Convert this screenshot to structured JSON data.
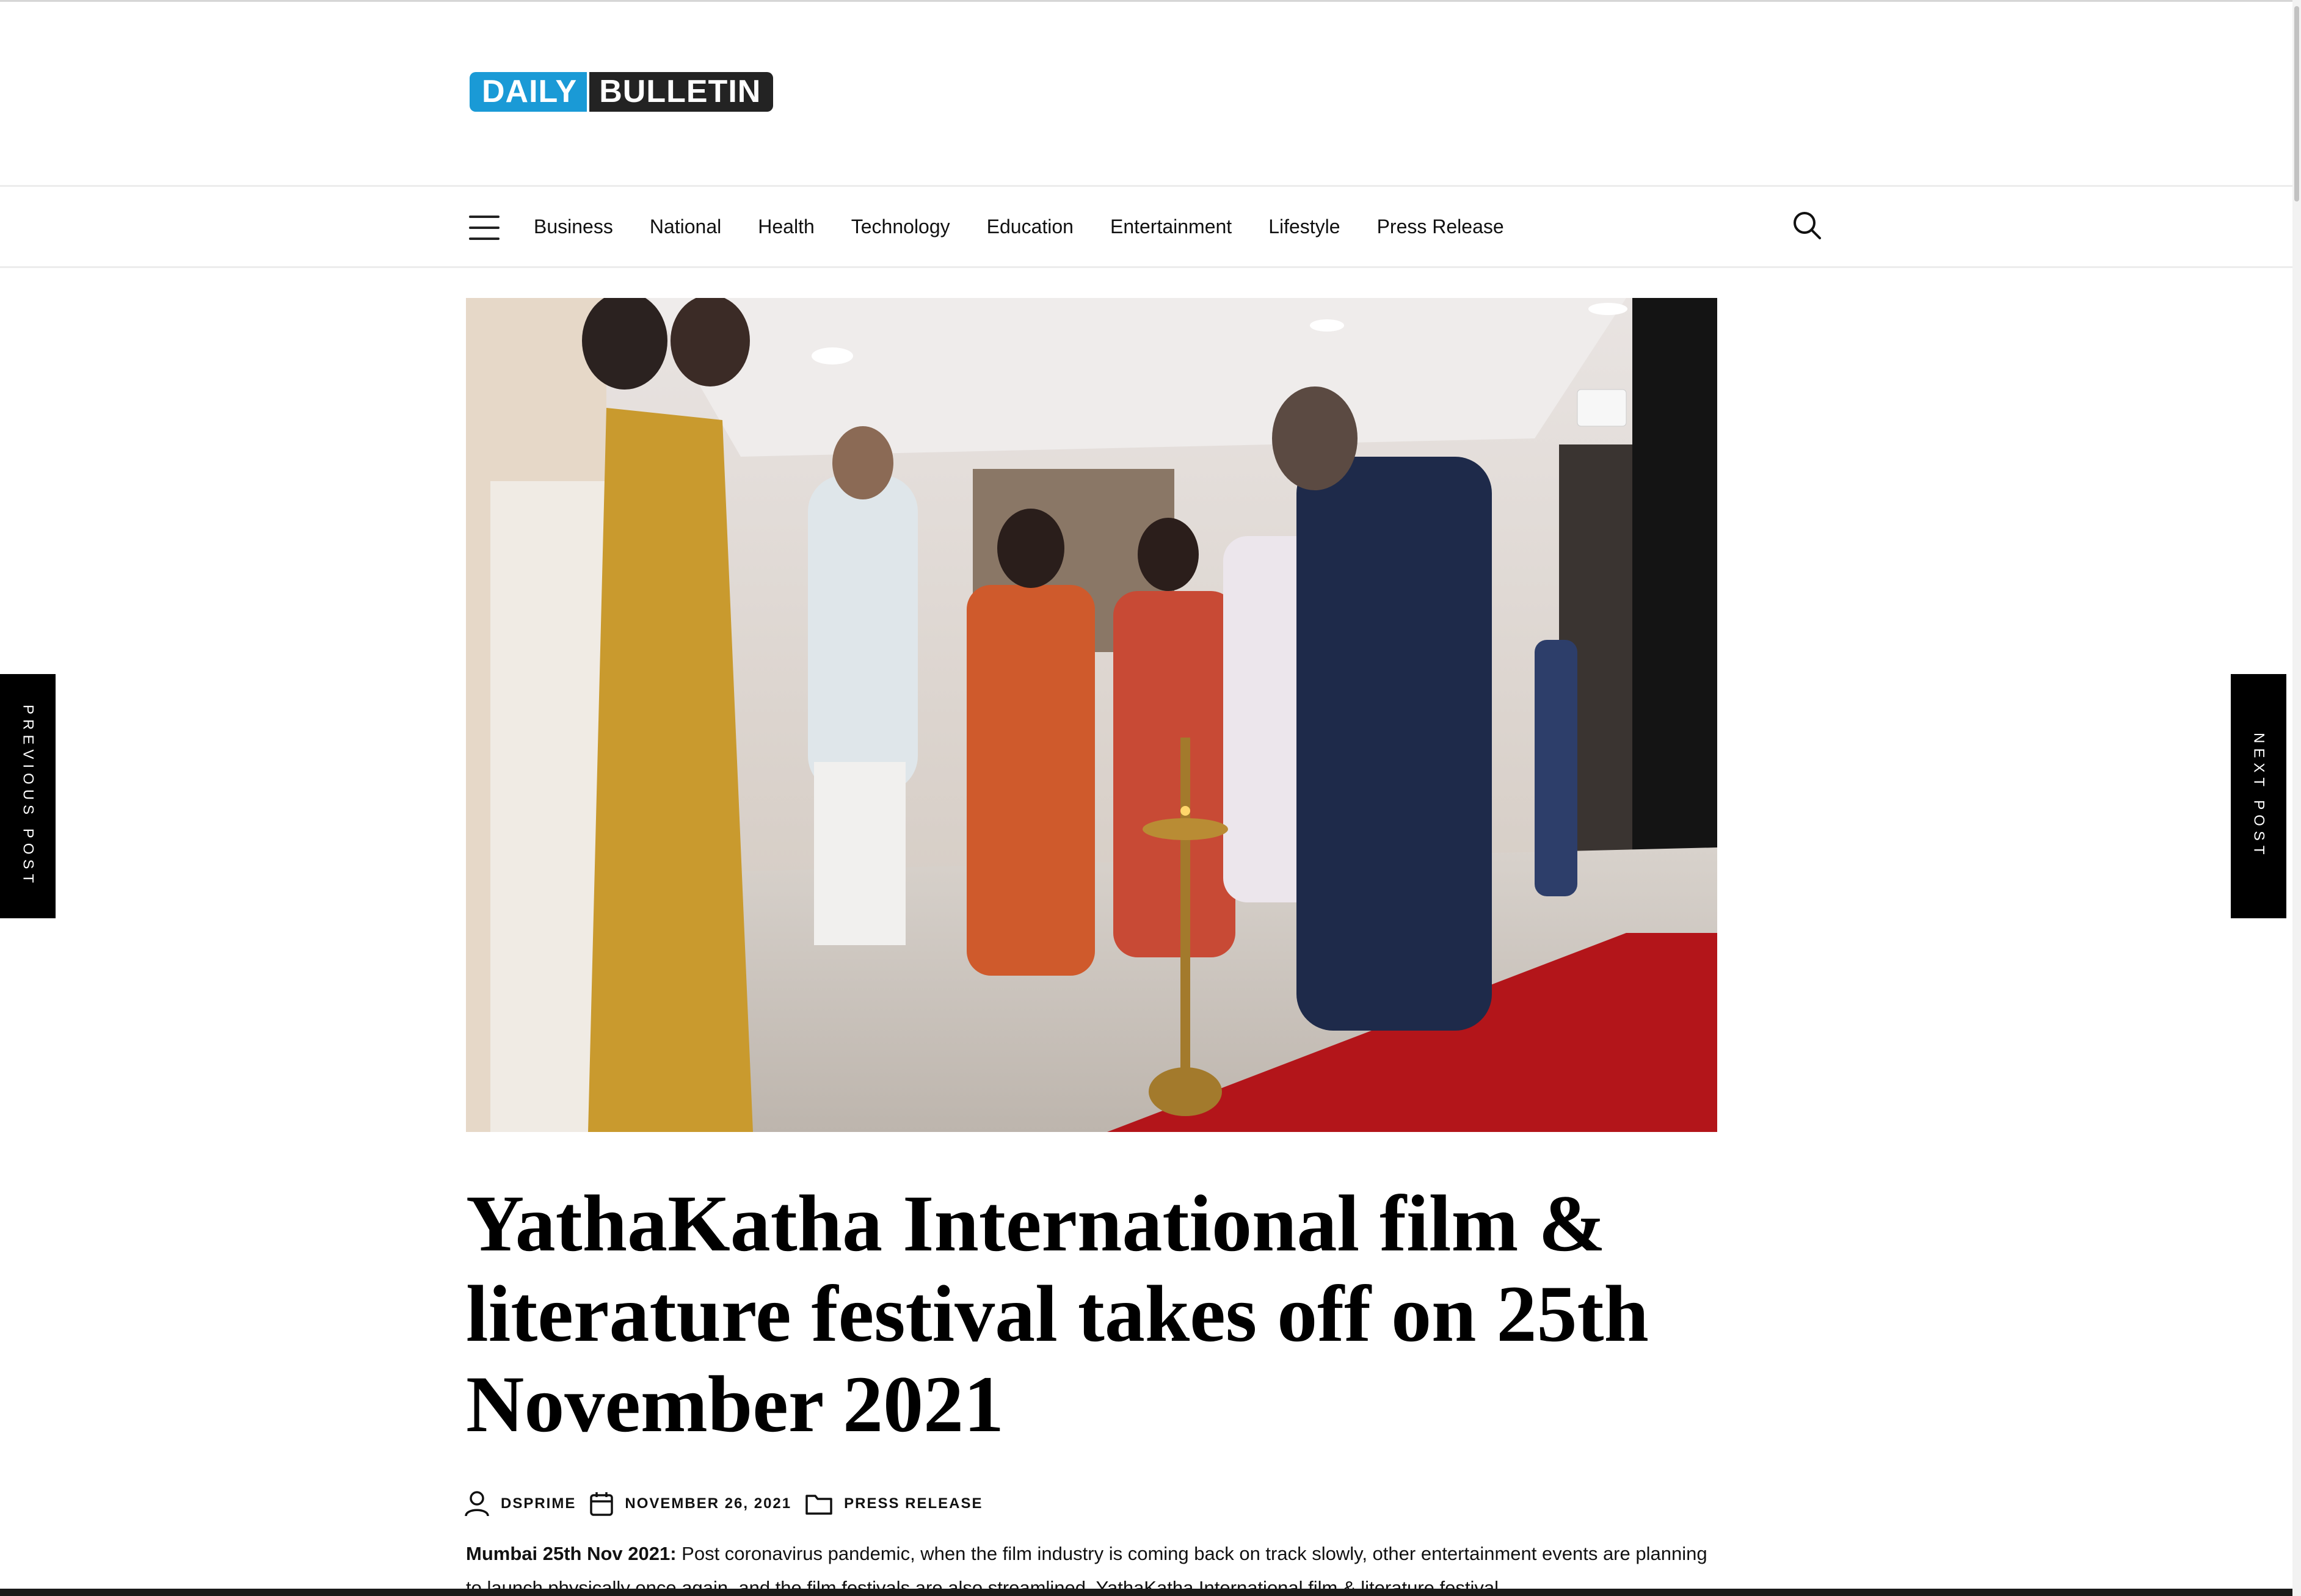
{
  "logo": {
    "part1": "DAILY",
    "part2": "BULLETIN",
    "colors": {
      "daily_bg": "#1a9ad6",
      "bulletin_bg": "#232323"
    }
  },
  "nav": {
    "items": [
      {
        "label": "Business"
      },
      {
        "label": "National"
      },
      {
        "label": "Health"
      },
      {
        "label": "Technology"
      },
      {
        "label": "Education"
      },
      {
        "label": "Entertainment"
      },
      {
        "label": "Lifestyle"
      },
      {
        "label": "Press Release"
      }
    ],
    "menu_icon": "hamburger-icon",
    "search_icon": "search-icon"
  },
  "post_nav": {
    "previous": "PREVIOUS POST",
    "next": "NEXT POST"
  },
  "article": {
    "title": "YathaKatha International film & literature festival takes off on 25th November 2021",
    "author": "DSPRIME",
    "date": "NOVEMBER 26, 2021",
    "category": "PRESS RELEASE",
    "lead": "Mumbai 25th Nov 2021:",
    "body": " Post coronavirus pandemic, when the film industry is coming back on track slowly, other entertainment events are planning to launch physically once again, and the film festivals are also streamlined. YathaKatha International film & literature festival"
  }
}
